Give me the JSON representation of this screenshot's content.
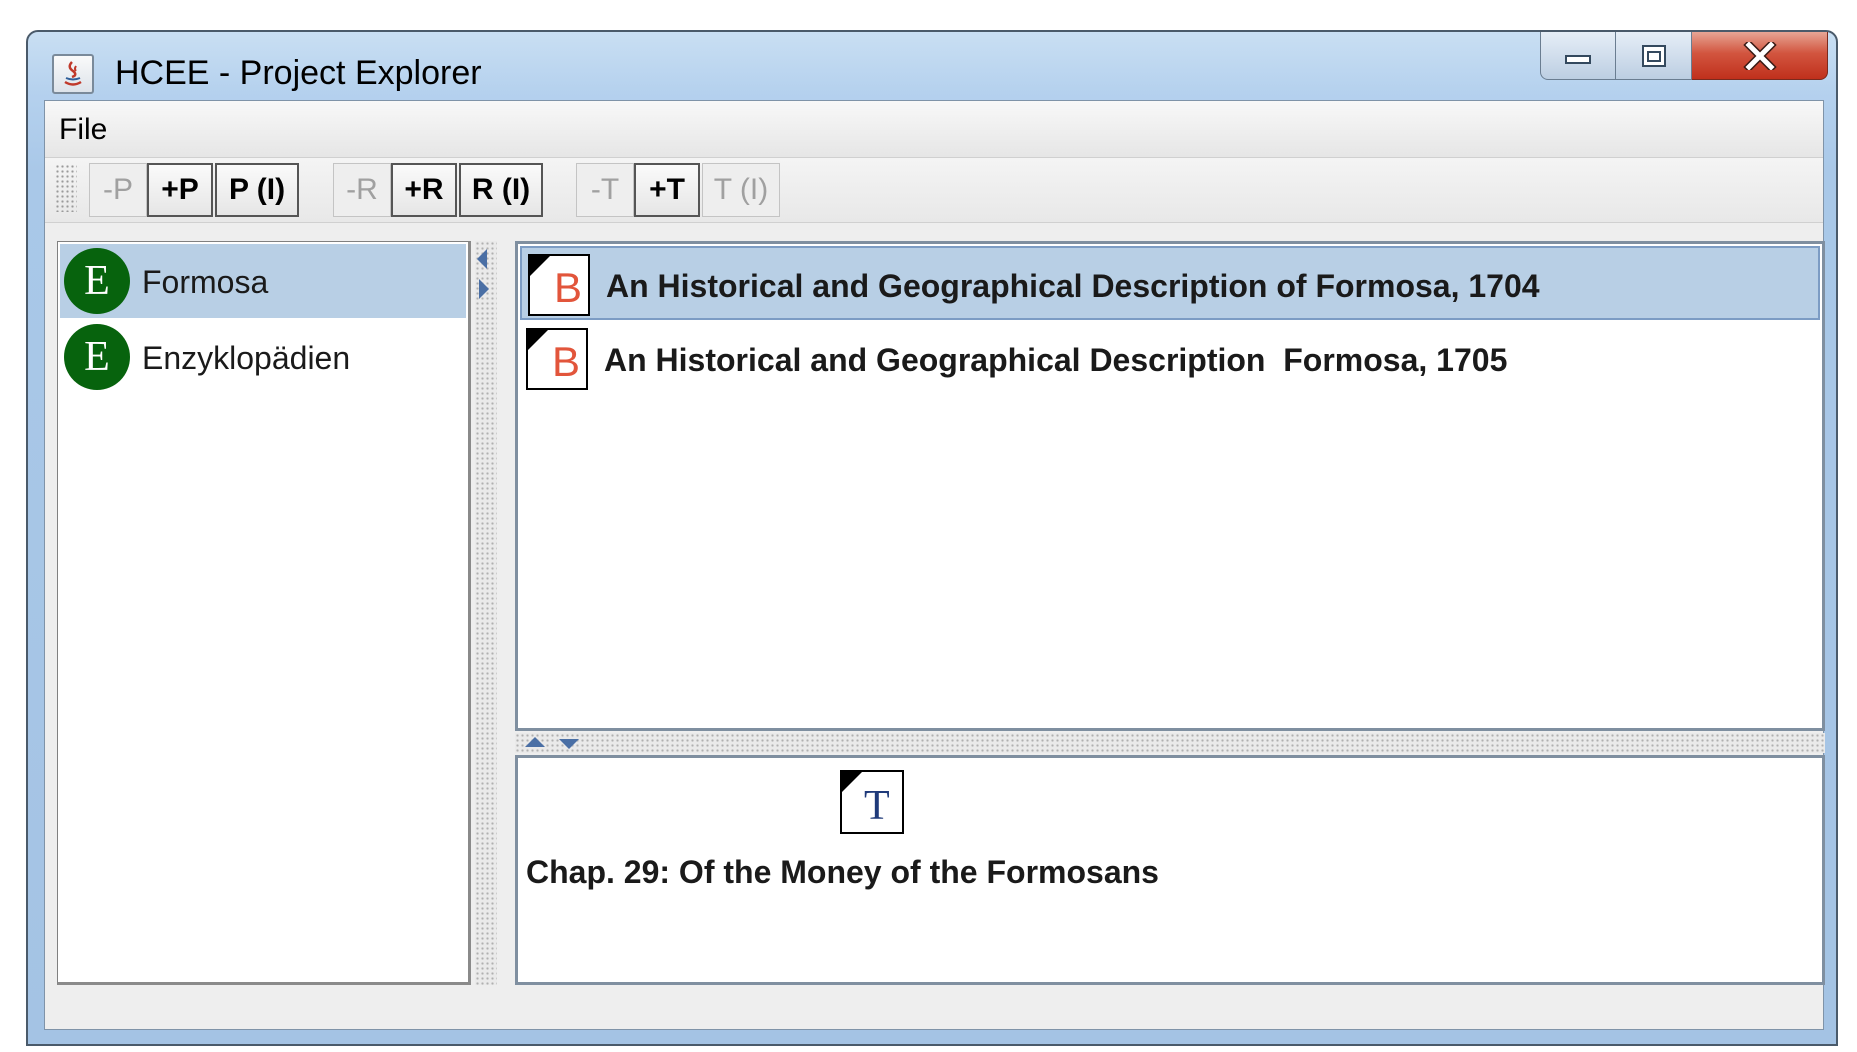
{
  "window": {
    "title": "HCEE - Project Explorer"
  },
  "menu": {
    "file": "File"
  },
  "toolbar": {
    "groups": [
      {
        "buttons": [
          {
            "label": "-P",
            "enabled": false
          },
          {
            "label": "+P",
            "enabled": true
          },
          {
            "label": "P (I)",
            "enabled": true
          }
        ]
      },
      {
        "buttons": [
          {
            "label": "-R",
            "enabled": false
          },
          {
            "label": "+R",
            "enabled": true
          },
          {
            "label": "R (I)",
            "enabled": true
          }
        ]
      },
      {
        "buttons": [
          {
            "label": "-T",
            "enabled": false
          },
          {
            "label": "+T",
            "enabled": true
          },
          {
            "label": "T (I)",
            "enabled": false
          }
        ]
      }
    ]
  },
  "projects": {
    "icon": "E",
    "items": [
      {
        "label": "Formosa",
        "selected": true
      },
      {
        "label": "Enzyklopädien",
        "selected": false
      }
    ]
  },
  "resources": {
    "icon": "B",
    "items": [
      {
        "label": "An Historical and Geographical Description of Formosa, 1704",
        "selected": true
      },
      {
        "label": "An Historical and Geographical Description  Formosa, 1705",
        "selected": false
      }
    ]
  },
  "text": {
    "icon": "T",
    "title": "Chap. 29: Of the Money of the Formosans"
  },
  "colors": {
    "selection": "#b8cfe5",
    "project_badge": "#07630d",
    "resource_letter": "#e2553b",
    "text_letter": "#1f3a7a"
  }
}
